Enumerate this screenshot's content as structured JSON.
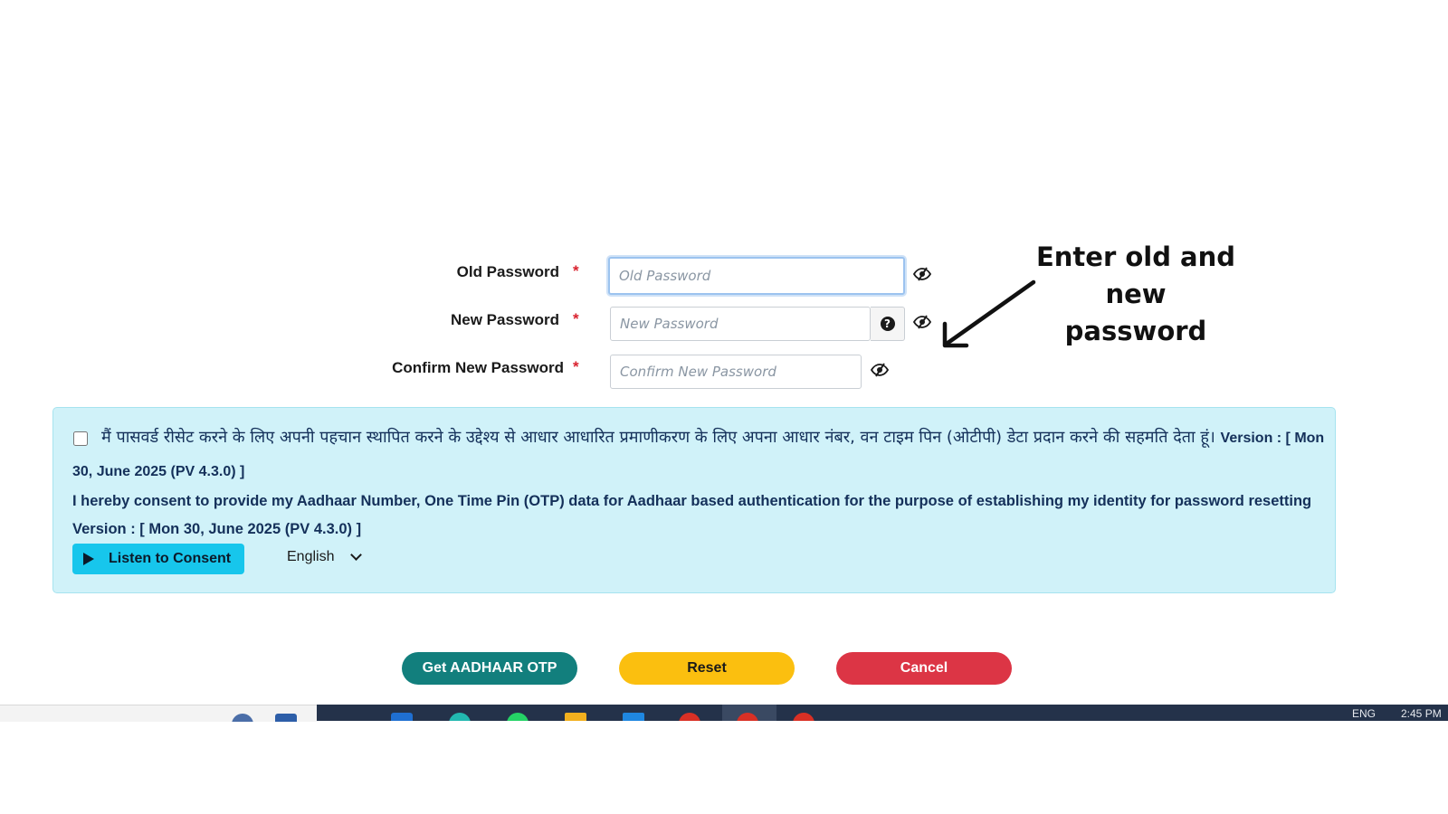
{
  "form": {
    "old_password": {
      "label": "Old Password",
      "required_mark": "*",
      "placeholder": "Old Password"
    },
    "new_password": {
      "label": "New Password",
      "required_mark": "*",
      "placeholder": "New Password",
      "help_icon_text": "?"
    },
    "confirm_password": {
      "label": "Confirm New Password",
      "required_mark": "*",
      "placeholder": "Confirm New Password"
    }
  },
  "annotation": {
    "text_line1": "Enter old and new",
    "text_line2": "password"
  },
  "consent": {
    "hindi_text": "मैं पासवर्ड रीसेट करने के लिए अपनी पहचान स्थापित करने के उद्देश्य से आधार आधारित प्रमाणीकरण के लिए अपना आधार नंबर, वन टाइम पिन (ओटीपी) डेटा प्रदान करने की सहमति देता हूं।",
    "hindi_version": "Version : [ Mon 30, June 2025 (PV 4.3.0) ]",
    "english_text": "I hereby consent to provide my Aadhaar Number, One Time Pin (OTP) data for Aadhaar based authentication for the purpose of establishing my identity for password resetting Version : [ Mon 30, June 2025 (PV 4.3.0) ]",
    "listen_label": "Listen to Consent",
    "language": "English"
  },
  "buttons": {
    "get_otp": "Get AADHAAR OTP",
    "reset": "Reset",
    "cancel": "Cancel"
  },
  "taskbar": {
    "lang": "ENG",
    "time": "2:45 PM"
  },
  "colors": {
    "consent_bg": "#d0f2f9",
    "otp_button": "#127f7d",
    "reset_button": "#fbbf0f",
    "cancel_button": "#dc3545",
    "listen_button": "#17c6ec",
    "required_mark": "#d9232f"
  }
}
